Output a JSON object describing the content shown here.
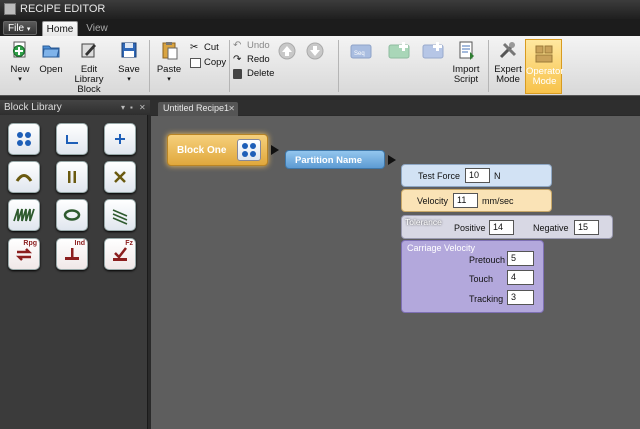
{
  "app": {
    "title": "RECIPE EDITOR"
  },
  "menu": {
    "file_label": "File"
  },
  "tabs": [
    {
      "label": "Home",
      "active": true
    },
    {
      "label": "View",
      "active": false
    }
  ],
  "ribbon": {
    "new_label": "New",
    "open_label": "Open",
    "edit_library_label": "Edit Library Block",
    "save_label": "Save",
    "paste_label": "Paste",
    "cut_label": "Cut",
    "copy_label": "Copy",
    "undo_label": "Undo",
    "redo_label": "Redo",
    "delete_label": "Delete",
    "import_script_label": "Import Script",
    "expert_mode_label": "Expert Mode",
    "operator_mode_label": "Operator Mode"
  },
  "block_library": {
    "title": "Block Library",
    "tiles": [
      {
        "icon": "four-dots-icon"
      },
      {
        "icon": "corner-icon"
      },
      {
        "icon": "plus-icon"
      },
      {
        "icon": "arc-icon"
      },
      {
        "icon": "pause-icon"
      },
      {
        "icon": "cross-icon"
      },
      {
        "icon": "sawtooth-icon"
      },
      {
        "icon": "ellipse-icon"
      },
      {
        "icon": "diagonal-lines-icon"
      },
      {
        "icon": "swap-arrows-icon",
        "sup": "Rpg"
      },
      {
        "icon": "indent-icon",
        "sup": "Ind"
      },
      {
        "icon": "force-check-icon",
        "sup": "Fz"
      }
    ]
  },
  "document": {
    "tab_label": "Untitled Recipe1",
    "block_one": {
      "label": "Block One"
    },
    "partition": {
      "label": "Partition Name"
    },
    "test_force": {
      "label": "Test Force",
      "value": "10",
      "unit": "N"
    },
    "velocity": {
      "label": "Velocity",
      "value": "11",
      "unit": "mm/sec"
    },
    "tolerance": {
      "tag": "Tolerance",
      "positive_label": "Positive",
      "positive_value": "14",
      "negative_label": "Negative",
      "negative_value": "15"
    },
    "carriage_velocity": {
      "title": "Carriage Velocity",
      "pretouch_label": "Pretouch",
      "pretouch_value": "5",
      "touch_label": "Touch",
      "touch_value": "4",
      "tracking_label": "Tracking",
      "tracking_value": "3"
    }
  },
  "colors": {
    "accent_orange": "#f7c24a",
    "partition_blue": "#5d9bd3",
    "canvas_gray": "#5e5e5e",
    "library_red": "#8b1f1f"
  }
}
